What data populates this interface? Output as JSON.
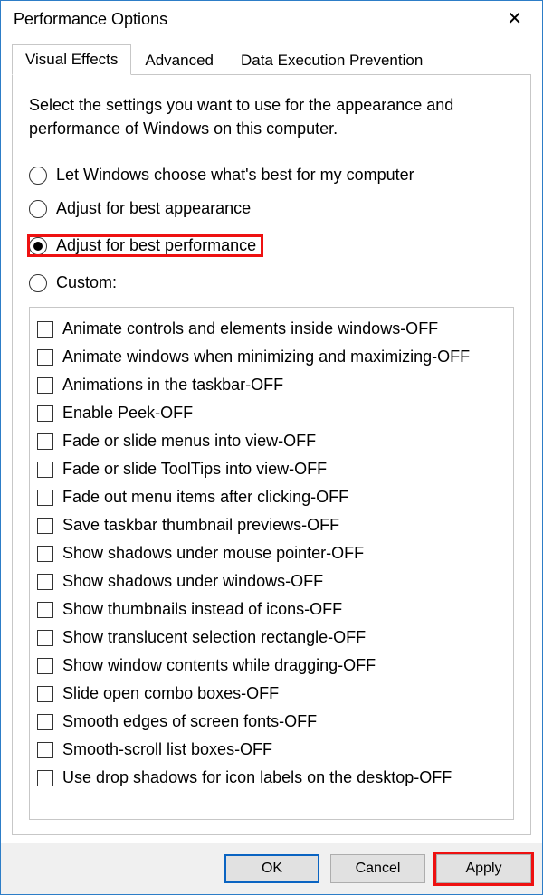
{
  "title": "Performance Options",
  "tabs": [
    {
      "label": "Visual Effects",
      "active": true
    },
    {
      "label": "Advanced",
      "active": false
    },
    {
      "label": "Data Execution Prevention",
      "active": false
    }
  ],
  "intro": "Select the settings you want to use for the appearance and performance of Windows on this computer.",
  "radios": [
    {
      "label": "Let Windows choose what's best for my computer",
      "selected": false,
      "highlight": false
    },
    {
      "label": "Adjust for best appearance",
      "selected": false,
      "highlight": false
    },
    {
      "label": "Adjust for best performance",
      "selected": true,
      "highlight": true
    },
    {
      "label": "Custom:",
      "selected": false,
      "highlight": false
    }
  ],
  "checks": [
    {
      "label": "Animate controls and elements inside windows-OFF",
      "checked": false
    },
    {
      "label": "Animate windows when minimizing and maximizing-OFF",
      "checked": false
    },
    {
      "label": "Animations in the taskbar-OFF",
      "checked": false
    },
    {
      "label": "Enable Peek-OFF",
      "checked": false
    },
    {
      "label": "Fade or slide menus into view-OFF",
      "checked": false
    },
    {
      "label": "Fade or slide ToolTips into view-OFF",
      "checked": false
    },
    {
      "label": "Fade out menu items after clicking-OFF",
      "checked": false
    },
    {
      "label": "Save taskbar thumbnail previews-OFF",
      "checked": false
    },
    {
      "label": "Show shadows under mouse pointer-OFF",
      "checked": false
    },
    {
      "label": "Show shadows under windows-OFF",
      "checked": false
    },
    {
      "label": "Show thumbnails instead of icons-OFF",
      "checked": false
    },
    {
      "label": "Show translucent selection rectangle-OFF",
      "checked": false
    },
    {
      "label": "Show window contents while dragging-OFF",
      "checked": false
    },
    {
      "label": "Slide open combo boxes-OFF",
      "checked": false
    },
    {
      "label": "Smooth edges of screen fonts-OFF",
      "checked": false
    },
    {
      "label": "Smooth-scroll list boxes-OFF",
      "checked": false
    },
    {
      "label": "Use drop shadows for icon labels on the desktop-OFF",
      "checked": false
    }
  ],
  "buttons": {
    "ok": "OK",
    "cancel": "Cancel",
    "apply": "Apply"
  }
}
